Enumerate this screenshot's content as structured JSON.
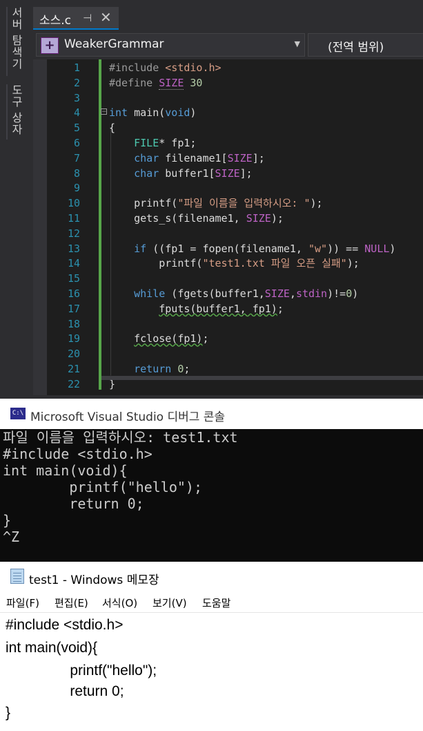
{
  "vs": {
    "side_tabs": [
      "서버 탐색기",
      "도구 상자"
    ],
    "doc_tab": {
      "name": "소스.c",
      "pin_icon": "pin-icon",
      "close_icon": "close-icon"
    },
    "nav": {
      "project": "WeakerGrammar",
      "scope": "(전역 범위)"
    },
    "lines": [
      {
        "n": "1",
        "html": "<span class='c-pre'>#include</span> <span class='c-str'>&lt;stdio.h&gt;</span>"
      },
      {
        "n": "2",
        "html": "<span class='c-pre'>#define</span> <span class='c-mac dotted'>SIZE</span> <span class='c-num'>30</span>"
      },
      {
        "n": "3",
        "html": ""
      },
      {
        "n": "4",
        "html": "<span class='c-kw'>int</span> main(<span class='c-kw'>void</span>)"
      },
      {
        "n": "5",
        "html": "{"
      },
      {
        "n": "6",
        "html": "    <span class='c-type'>FILE</span>* fp1;"
      },
      {
        "n": "7",
        "html": "    <span class='c-kw'>char</span> filename1[<span class='c-mac'>SIZE</span>];"
      },
      {
        "n": "8",
        "html": "    <span class='c-kw'>char</span> buffer1[<span class='c-mac'>SIZE</span>];"
      },
      {
        "n": "9",
        "html": ""
      },
      {
        "n": "10",
        "html": "    printf(<span class='c-str'>\"파일 이름을 입력하시오: \"</span>);"
      },
      {
        "n": "11",
        "html": "    gets_s(filename1, <span class='c-mac'>SIZE</span>);"
      },
      {
        "n": "12",
        "html": ""
      },
      {
        "n": "13",
        "html": "    <span class='c-kw'>if</span> ((fp1 = fopen(filename1, <span class='c-str'>\"w\"</span>)) == <span class='c-mac'>NULL</span>)"
      },
      {
        "n": "14",
        "html": "        printf(<span class='c-str'>\"test1.txt 파일 오픈 실패\"</span>);"
      },
      {
        "n": "15",
        "html": ""
      },
      {
        "n": "16",
        "html": "    <span class='c-kw'>while</span> (fgets(buffer1,<span class='c-mac'>SIZE</span>,<span class='c-mac'>stdin</span>)!=<span class='c-num'>0</span>)"
      },
      {
        "n": "17",
        "html": "        <span class='squig'>fputs(buffer1, fp1)</span>;"
      },
      {
        "n": "18",
        "html": ""
      },
      {
        "n": "19",
        "html": "    <span class='squig'>fclose(fp1)</span>;"
      },
      {
        "n": "20",
        "html": ""
      },
      {
        "n": "21",
        "html": "    <span class='c-kw'>return</span> <span class='c-num'>0</span>;"
      },
      {
        "n": "22",
        "html": "}"
      }
    ]
  },
  "console": {
    "title": "Microsoft Visual Studio 디버그 콘솔",
    "icon_label": "C:\\",
    "lines": [
      "파일 이름을 입력하시오: test1.txt",
      "#include <stdio.h>",
      "int main(void){",
      "        printf(\"hello\");",
      "        return 0;",
      "}",
      "^Z"
    ]
  },
  "notepad": {
    "title": "test1 - Windows 메모장",
    "menu": [
      "파일(F)",
      "편집(E)",
      "서식(O)",
      "보기(V)",
      "도움말"
    ],
    "lines": [
      "#include <stdio.h>",
      "int main(void){",
      "                printf(\"hello\");",
      "                return 0;",
      "}"
    ]
  },
  "colors": {
    "vs_background": "#1e1e1e",
    "vs_chrome": "#2d2d30",
    "accent": "#007acc",
    "keyword": "#569cd6",
    "string": "#d69d85",
    "macro": "#bd63c5",
    "line_number": "#2b91af"
  }
}
